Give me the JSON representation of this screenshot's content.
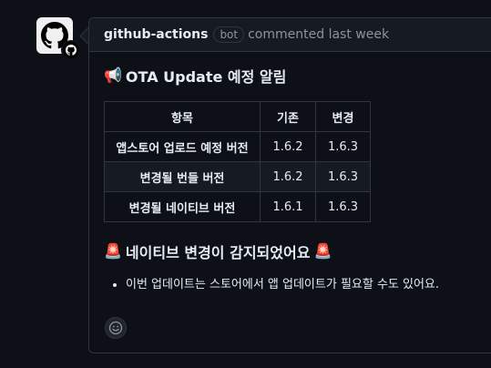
{
  "comment": {
    "author": "github-actions",
    "badge": "bot",
    "meta": "commented last week",
    "title_icon": "📢",
    "title": "OTA Update 예정 알림",
    "table": {
      "headers": [
        "항목",
        "기존",
        "변경"
      ],
      "rows": [
        [
          "앱스토어 업로드 예정 버전",
          "1.6.2",
          "1.6.3"
        ],
        [
          "변경될 번들 버전",
          "1.6.2",
          "1.6.3"
        ],
        [
          "변경될 네이티브 버전",
          "1.6.1",
          "1.6.3"
        ]
      ]
    },
    "subtitle_icon_left": "🚨",
    "subtitle": "네이티브 변경이 감지되었어요",
    "subtitle_icon_right": "🚨",
    "bullets": [
      "이번 업데이트는 스토어에서 앱 업데이트가 필요할 수도 있어요."
    ]
  },
  "icons": {
    "avatar": "github-logo-icon",
    "badge": "github-mini-icon",
    "reaction": "smiley-icon"
  }
}
